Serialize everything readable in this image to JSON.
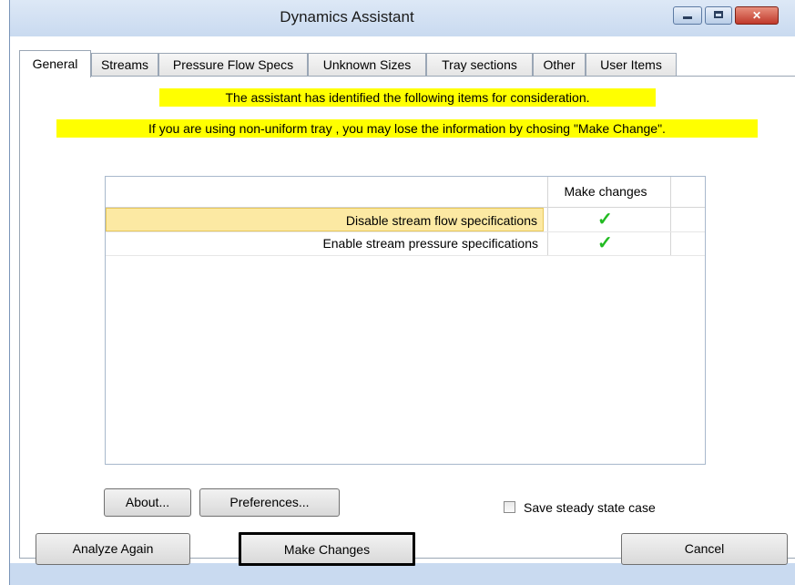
{
  "window": {
    "title": "Dynamics Assistant"
  },
  "tabs": [
    {
      "label": "General",
      "active": true
    },
    {
      "label": "Streams"
    },
    {
      "label": "Pressure Flow Specs"
    },
    {
      "label": "Unknown Sizes"
    },
    {
      "label": "Tray sections"
    },
    {
      "label": "Other"
    },
    {
      "label": "User Items"
    }
  ],
  "general": {
    "banner_1": "The assistant has identified the following items for consideration.",
    "banner_2": "If you are using non-uniform tray , you may lose the information by chosing \"Make Change\".",
    "grid": {
      "columns": [
        "",
        "Make changes",
        ""
      ],
      "rows": [
        {
          "description": "Disable stream flow specifications",
          "make_change": true,
          "selected": true
        },
        {
          "description": "Enable stream pressure specifications",
          "make_change": true,
          "selected": false
        }
      ]
    },
    "about_button": "About...",
    "preferences_button": "Preferences...",
    "save_steady_state_label": "Save steady state case",
    "save_steady_state_checked": false
  },
  "footer": {
    "analyze_again": "Analyze Again",
    "make_changes": "Make Changes",
    "cancel": "Cancel"
  },
  "colors": {
    "banner": "#ffff00",
    "check": "#22bb22",
    "selection": "#fce9a3",
    "frame": "#c9daf0"
  },
  "icons": {
    "minimize": "minimize-icon",
    "maximize": "maximize-icon",
    "close": "close-icon",
    "check": "checkmark-icon"
  }
}
